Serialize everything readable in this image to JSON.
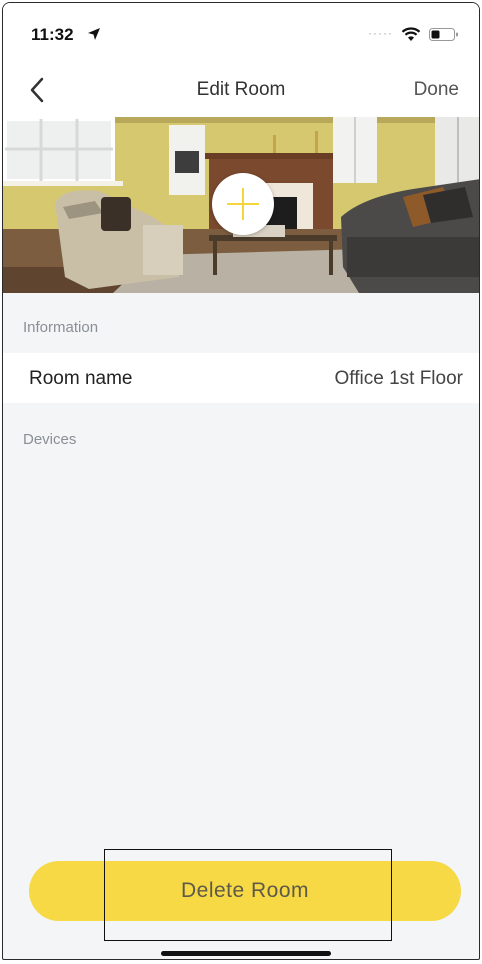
{
  "status_bar": {
    "time": "11:32",
    "icons": [
      "location-arrow-icon",
      "cellular-signal-icon",
      "wifi-icon",
      "battery-icon"
    ]
  },
  "nav": {
    "back_icon": "chevron-left-icon",
    "title": "Edit Room",
    "done_label": "Done"
  },
  "photo": {
    "add_icon": "plus-icon",
    "accent_color": "#f5d53a"
  },
  "information": {
    "section_label": "Information",
    "room_name_label": "Room name",
    "room_name_value": "Office 1st Floor"
  },
  "devices": {
    "section_label": "Devices"
  },
  "actions": {
    "delete_label": "Delete Room",
    "delete_color": "#f6d944"
  }
}
